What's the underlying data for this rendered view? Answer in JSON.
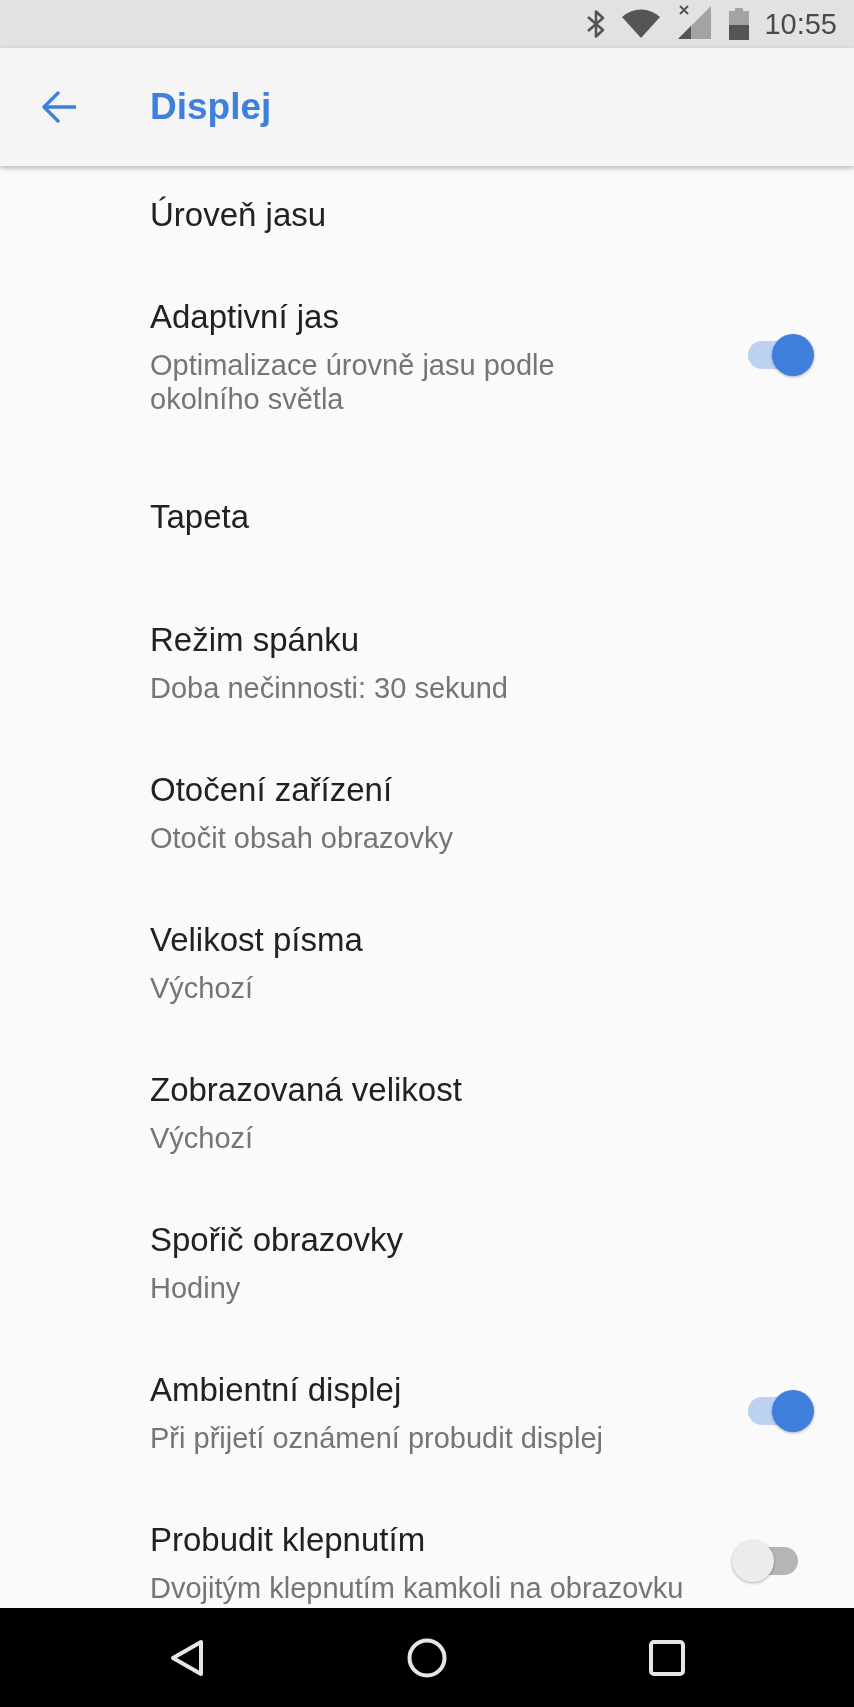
{
  "status_bar": {
    "time": "10:55"
  },
  "app_bar": {
    "title": "Displej"
  },
  "settings": [
    {
      "kind": "plain",
      "title": "Úroveň jasu"
    },
    {
      "kind": "switch",
      "title": "Adaptivní jas",
      "summary": "Optimalizace úrovně jasu podle\nokolního světla",
      "checked": true
    },
    {
      "kind": "plain",
      "title": "Tapeta"
    },
    {
      "kind": "plain",
      "title": "Režim spánku",
      "summary": "Doba nečinnosti: 30 sekund"
    },
    {
      "kind": "plain",
      "title": "Otočení zařízení",
      "summary": "Otočit obsah obrazovky"
    },
    {
      "kind": "plain",
      "title": "Velikost písma",
      "summary": "Výchozí"
    },
    {
      "kind": "plain",
      "title": "Zobrazovaná velikost",
      "summary": "Výchozí"
    },
    {
      "kind": "plain",
      "title": "Spořič obrazovky",
      "summary": "Hodiny"
    },
    {
      "kind": "switch",
      "title": "Ambientní displej",
      "summary": "Při přijetí oznámení probudit displej",
      "checked": true
    },
    {
      "kind": "switch",
      "title": "Probudit klepnutím",
      "summary": "Dvojitým klepnutím kamkoli na obrazovku",
      "checked": false
    }
  ]
}
